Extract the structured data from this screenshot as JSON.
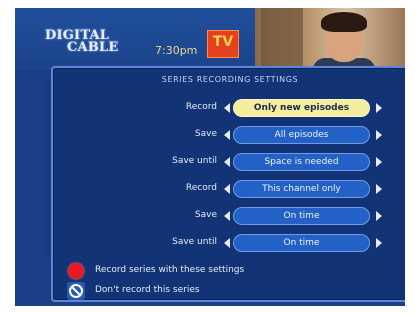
{
  "header": {
    "brand_line1": "DIGITAL",
    "brand_line2": "CABLE",
    "time": "7:30pm",
    "channel_logo": "TV"
  },
  "dialog": {
    "title": "SERIES RECORDING SETTINGS",
    "rows": [
      {
        "label": "Record",
        "value": "Only new episodes",
        "selected": true
      },
      {
        "label": "Save",
        "value": "All episodes",
        "selected": false
      },
      {
        "label": "Save until",
        "value": "Space is needed",
        "selected": false
      },
      {
        "label": "Record",
        "value": "This channel only",
        "selected": false
      },
      {
        "label": "Save",
        "value": "On time",
        "selected": false
      },
      {
        "label": "Save until",
        "value": "On time",
        "selected": false
      }
    ],
    "actions": [
      {
        "label": "Record series with these settings",
        "icon": "record-dot-icon"
      },
      {
        "label": "Don't record this series",
        "icon": "no-symbol-icon"
      }
    ]
  },
  "colors": {
    "background": "#1a3f86",
    "selected_option": "#f4ec9e",
    "option": "#2361c6",
    "record_red": "#e51b23"
  }
}
